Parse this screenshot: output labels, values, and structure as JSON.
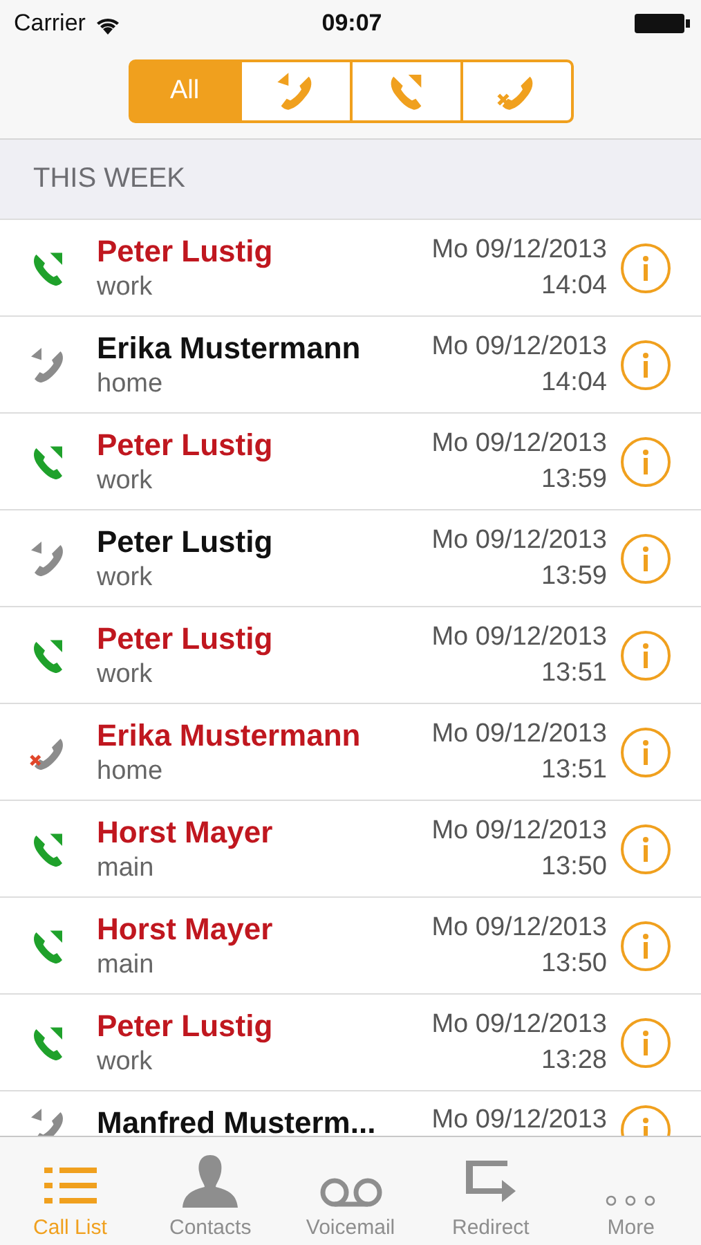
{
  "status_bar": {
    "carrier": "Carrier",
    "time": "09:07"
  },
  "filter": [
    {
      "kind": "text",
      "label": "All",
      "selected": true
    },
    {
      "kind": "outgoing",
      "selected": false
    },
    {
      "kind": "incoming",
      "selected": false
    },
    {
      "kind": "missed",
      "selected": false
    }
  ],
  "section": {
    "title": "THIS WEEK"
  },
  "calls": [
    {
      "kind": "incoming",
      "highlighted": true,
      "name": "Peter Lustig",
      "line": "work",
      "date": "Mo 09/12/2013",
      "time": "14:04"
    },
    {
      "kind": "outgoing",
      "highlighted": false,
      "name": "Erika Mustermann",
      "line": "home",
      "date": "Mo 09/12/2013",
      "time": "14:04"
    },
    {
      "kind": "incoming",
      "highlighted": true,
      "name": "Peter Lustig",
      "line": "work",
      "date": "Mo 09/12/2013",
      "time": "13:59"
    },
    {
      "kind": "outgoing",
      "highlighted": false,
      "name": "Peter Lustig",
      "line": "work",
      "date": "Mo 09/12/2013",
      "time": "13:59"
    },
    {
      "kind": "incoming",
      "highlighted": true,
      "name": "Peter Lustig",
      "line": "work",
      "date": "Mo 09/12/2013",
      "time": "13:51"
    },
    {
      "kind": "missed",
      "highlighted": true,
      "name": "Erika Mustermann",
      "line": "home",
      "date": "Mo 09/12/2013",
      "time": "13:51"
    },
    {
      "kind": "incoming",
      "highlighted": true,
      "name": "Horst Mayer",
      "line": "main",
      "date": "Mo 09/12/2013",
      "time": "13:50"
    },
    {
      "kind": "incoming",
      "highlighted": true,
      "name": "Horst Mayer",
      "line": "main",
      "date": "Mo 09/12/2013",
      "time": "13:50"
    },
    {
      "kind": "incoming",
      "highlighted": true,
      "name": "Peter Lustig",
      "line": "work",
      "date": "Mo 09/12/2013",
      "time": "13:28"
    },
    {
      "kind": "outgoing",
      "highlighted": false,
      "name": "Manfred Musterm...",
      "date": "Mo 09/12/2013"
    }
  ],
  "tab_bar": [
    {
      "kind": "list",
      "label": "Call List",
      "selected": true
    },
    {
      "kind": "person",
      "label": "Contacts",
      "selected": false
    },
    {
      "kind": "voicemail",
      "label": "Voicemail",
      "selected": false
    },
    {
      "kind": "redirect",
      "label": "Redirect",
      "selected": false
    },
    {
      "kind": "more",
      "label": "More",
      "selected": false
    }
  ]
}
